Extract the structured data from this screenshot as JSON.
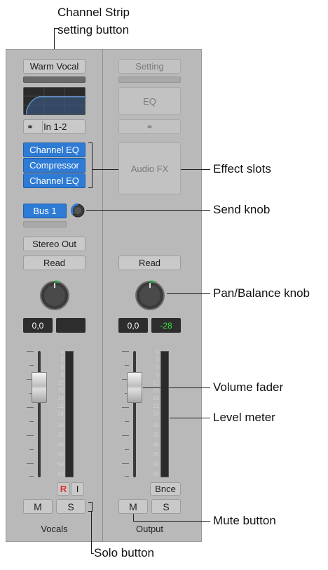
{
  "callouts": {
    "channel_strip_setting": [
      "Channel Strip",
      "setting button"
    ],
    "effect_slots": "Effect slots",
    "send_knob": "Send knob",
    "pan_balance_knob": "Pan/Balance knob",
    "volume_fader": "Volume fader",
    "level_meter": "Level meter",
    "mute_button": "Mute button",
    "solo_button": "Solo button"
  },
  "strips": {
    "vocals": {
      "setting": "Warm Vocal",
      "input": "In 1-2",
      "effects": [
        "Channel EQ",
        "Compressor",
        "Channel EQ"
      ],
      "send": "Bus 1",
      "output": "Stereo Out",
      "automation": "Read",
      "volume": "0,0",
      "peak": "",
      "record": "R",
      "monitor": "I",
      "mute": "M",
      "solo": "S",
      "name": "Vocals"
    },
    "output": {
      "setting": "Setting",
      "eq": "EQ",
      "audio_fx": "Audio FX",
      "automation": "Read",
      "volume": "0,0",
      "peak": "-28",
      "bounce": "Bnce",
      "mute": "M",
      "solo": "S",
      "name": "Output"
    }
  },
  "meter_scale": [
    "0",
    "3",
    "6",
    "9",
    "12",
    "15",
    "18",
    "21",
    "24",
    "30",
    "35",
    "40",
    "45",
    "50",
    "60"
  ],
  "colors": {
    "slot_blue": "#2e7bd6",
    "peak_green": "#3ddc3d",
    "record_red": "#e03030",
    "knob_green": "#2fa84f"
  }
}
